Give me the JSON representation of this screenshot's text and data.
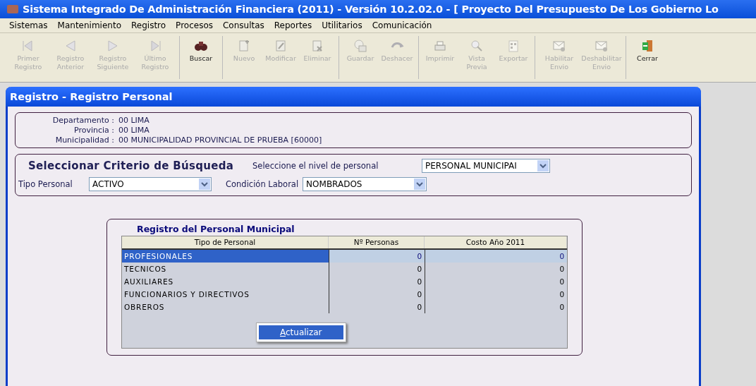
{
  "window": {
    "title": "Sistema Integrado De Administración Financiera (2011) - Versión 10.2.02.0 - [ Proyecto Del Presupuesto De Los Gobierno Lo"
  },
  "menu": [
    "Sistemas",
    "Mantenimiento",
    "Registro",
    "Procesos",
    "Consultas",
    "Reportes",
    "Utilitarios",
    "Comunicación"
  ],
  "toolbar": [
    [
      {
        "label": "Primer Registro",
        "disabled": true
      },
      {
        "label": "Registro Anterior",
        "disabled": true
      },
      {
        "label": "Registro Siguiente",
        "disabled": true
      },
      {
        "label": "Último Registro",
        "disabled": true
      }
    ],
    [
      {
        "label": "Buscar",
        "disabled": false
      }
    ],
    [
      {
        "label": "Nuevo",
        "disabled": true
      },
      {
        "label": "Modificar",
        "disabled": true
      },
      {
        "label": "Eliminar",
        "disabled": true
      }
    ],
    [
      {
        "label": "Guardar",
        "disabled": true
      },
      {
        "label": "Deshacer",
        "disabled": true
      }
    ],
    [
      {
        "label": "Imprimir",
        "disabled": true
      },
      {
        "label": "Vista Previa",
        "disabled": true
      },
      {
        "label": "Exportar",
        "disabled": true
      }
    ],
    [
      {
        "label": "Habilitar Envio",
        "disabled": true
      },
      {
        "label": "Deshabilitar Envio",
        "disabled": true
      }
    ],
    [
      {
        "label": "Cerrar",
        "disabled": false
      }
    ]
  ],
  "form": {
    "title": "Registro - Registro Personal",
    "location": [
      {
        "label": "Departamento :",
        "value": "00  LIMA"
      },
      {
        "label": "Provincia :",
        "value": "00  LIMA"
      },
      {
        "label": "Municipalidad :",
        "value": "00  MUNICIPALIDAD PROVINCIAL DE PRUEBA [60000]"
      }
    ],
    "criteria": {
      "heading": "Seleccionar Criterio de Búsqueda",
      "nivel": {
        "label": "Seleccione el nivel de personal",
        "value": "PERSONAL MUNICIPAI"
      },
      "tipo": {
        "label": "Tipo Personal",
        "value": "ACTIVO"
      },
      "condicion": {
        "label": "Condición Laboral",
        "value": "NOMBRADOS"
      }
    },
    "table": {
      "title": "Registro del Personal Municipal",
      "columns": [
        "Tipo de Personal",
        "Nº Personas",
        "Costo Año 2011"
      ],
      "rows": [
        {
          "cells": [
            "PROFESIONALES",
            "0",
            "0"
          ],
          "selected": true
        },
        {
          "cells": [
            "TECNICOS",
            "0",
            "0"
          ],
          "selected": false
        },
        {
          "cells": [
            "AUXILIARES",
            "0",
            "0"
          ],
          "selected": false
        },
        {
          "cells": [
            "FUNCIONARIOS Y DIRECTIVOS",
            "0",
            "0"
          ],
          "selected": false
        },
        {
          "cells": [
            "OBREROS",
            "0",
            "0"
          ],
          "selected": false
        }
      ]
    },
    "context_menu": [
      "Actualizar"
    ]
  }
}
